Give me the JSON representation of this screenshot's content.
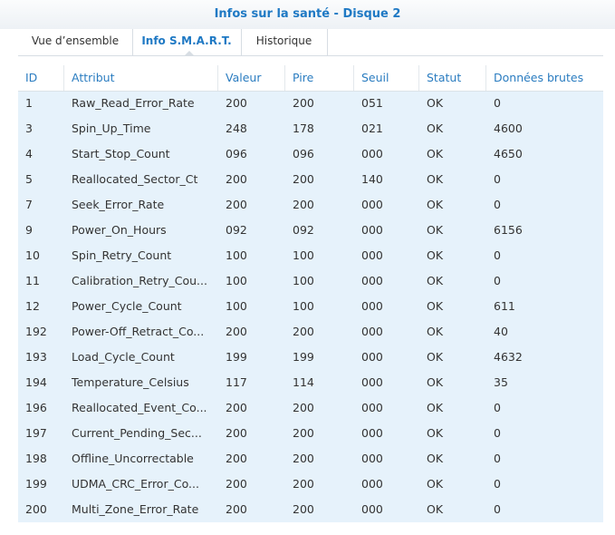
{
  "window": {
    "title": "Infos sur la santé - Disque 2"
  },
  "tabs": [
    {
      "label": "Vue d’ensemble",
      "active": false
    },
    {
      "label": "Info S.M.A.R.T.",
      "active": true
    },
    {
      "label": "Historique",
      "active": false
    }
  ],
  "table": {
    "columns": [
      "ID",
      "Attribut",
      "Valeur",
      "Pire",
      "Seuil",
      "Statut",
      "Données brutes"
    ],
    "rows": [
      [
        "1",
        "Raw_Read_Error_Rate",
        "200",
        "200",
        "051",
        "OK",
        "0"
      ],
      [
        "3",
        "Spin_Up_Time",
        "248",
        "178",
        "021",
        "OK",
        "4600"
      ],
      [
        "4",
        "Start_Stop_Count",
        "096",
        "096",
        "000",
        "OK",
        "4650"
      ],
      [
        "5",
        "Reallocated_Sector_Ct",
        "200",
        "200",
        "140",
        "OK",
        "0"
      ],
      [
        "7",
        "Seek_Error_Rate",
        "200",
        "200",
        "000",
        "OK",
        "0"
      ],
      [
        "9",
        "Power_On_Hours",
        "092",
        "092",
        "000",
        "OK",
        "6156"
      ],
      [
        "10",
        "Spin_Retry_Count",
        "100",
        "100",
        "000",
        "OK",
        "0"
      ],
      [
        "11",
        "Calibration_Retry_Cou...",
        "100",
        "100",
        "000",
        "OK",
        "0"
      ],
      [
        "12",
        "Power_Cycle_Count",
        "100",
        "100",
        "000",
        "OK",
        "611"
      ],
      [
        "192",
        "Power-Off_Retract_Co...",
        "200",
        "200",
        "000",
        "OK",
        "40"
      ],
      [
        "193",
        "Load_Cycle_Count",
        "199",
        "199",
        "000",
        "OK",
        "4632"
      ],
      [
        "194",
        "Temperature_Celsius",
        "117",
        "114",
        "000",
        "OK",
        "35"
      ],
      [
        "196",
        "Reallocated_Event_Co...",
        "200",
        "200",
        "000",
        "OK",
        "0"
      ],
      [
        "197",
        "Current_Pending_Sec...",
        "200",
        "200",
        "000",
        "OK",
        "0"
      ],
      [
        "198",
        "Offline_Uncorrectable",
        "200",
        "200",
        "000",
        "OK",
        "0"
      ],
      [
        "199",
        "UDMA_CRC_Error_Co...",
        "200",
        "200",
        "000",
        "OK",
        "0"
      ],
      [
        "200",
        "Multi_Zone_Error_Rate",
        "200",
        "200",
        "000",
        "OK",
        "0"
      ]
    ]
  },
  "colors": {
    "accent": "#1f79c4",
    "grid_background": "#e6f2fb",
    "header_text": "#2a7cc0",
    "cell_text": "#333333"
  }
}
